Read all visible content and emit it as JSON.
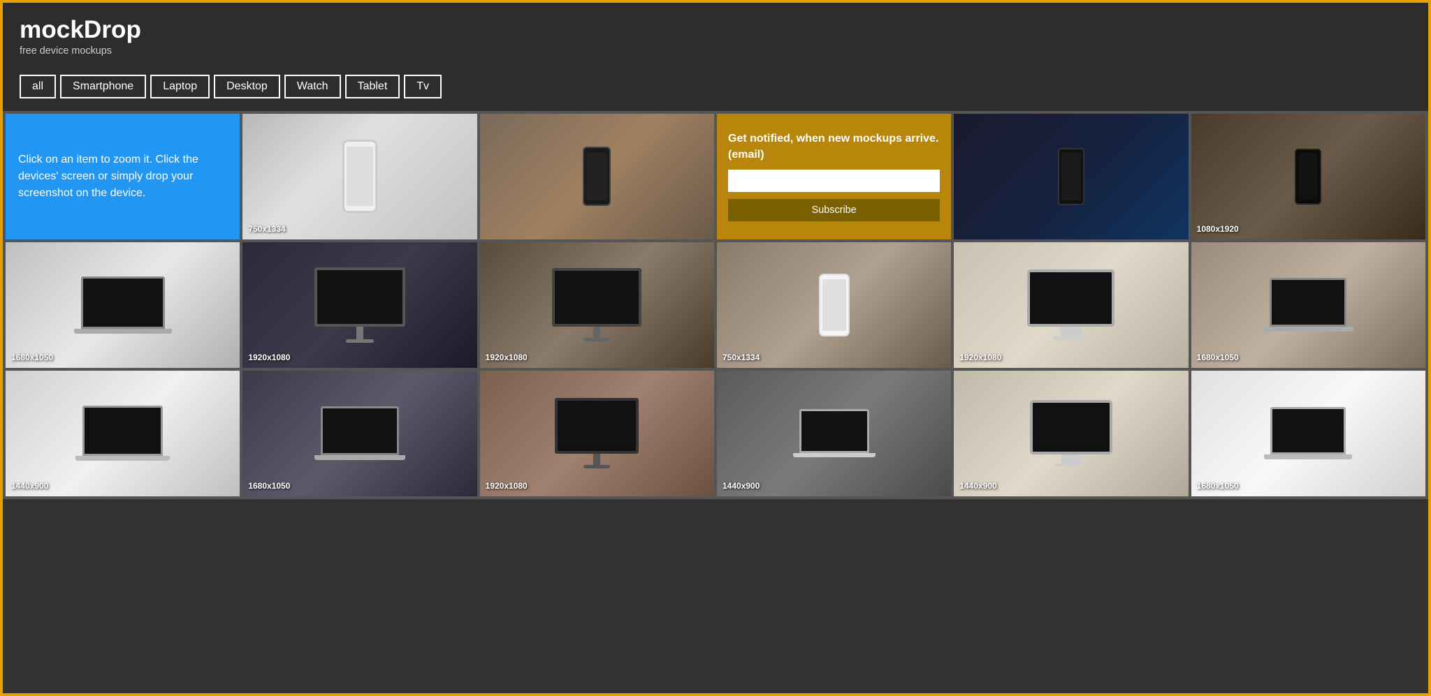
{
  "header": {
    "title": "mockDrop",
    "subtitle": "free device mockups"
  },
  "filters": {
    "buttons": [
      {
        "label": "all",
        "id": "filter-all"
      },
      {
        "label": "Smartphone",
        "id": "filter-smartphone"
      },
      {
        "label": "Laptop",
        "id": "filter-laptop"
      },
      {
        "label": "Desktop",
        "id": "filter-desktop"
      },
      {
        "label": "Watch",
        "id": "filter-watch"
      },
      {
        "label": "Tablet",
        "id": "filter-tablet"
      },
      {
        "label": "Tv",
        "id": "filter-tv"
      }
    ]
  },
  "info_box": {
    "text": "Click on an item to zoom it. Click the devices' screen or simply drop your screenshot on the device."
  },
  "notify_box": {
    "heading": "Get notified, when new mockups arrive. (email)",
    "input_placeholder": "",
    "button_label": "Subscribe"
  },
  "grid_items": [
    {
      "id": "item-1",
      "type": "info"
    },
    {
      "id": "item-2",
      "type": "phone",
      "size": "750x1334",
      "photo": "photo-1"
    },
    {
      "id": "item-3",
      "type": "phone_dark",
      "size": "",
      "photo": "photo-2"
    },
    {
      "id": "item-4",
      "type": "notify"
    },
    {
      "id": "item-5",
      "type": "phone_holding",
      "size": "",
      "photo": "photo-3"
    },
    {
      "id": "item-6",
      "type": "phone_holding2",
      "size": "1080x1920",
      "photo": "photo-4"
    },
    {
      "id": "item-7",
      "type": "laptop",
      "size": "1680x1050",
      "photo": "photo-5"
    },
    {
      "id": "item-8",
      "type": "monitor",
      "size": "1920x1080",
      "photo": "photo-6"
    },
    {
      "id": "item-9",
      "type": "monitor",
      "size": "1920x1080",
      "photo": "photo-7"
    },
    {
      "id": "item-10",
      "type": "phone",
      "size": "750x1334",
      "photo": "photo-8"
    },
    {
      "id": "item-11",
      "type": "monitor_desk",
      "size": "1920x1080",
      "photo": "photo-9"
    },
    {
      "id": "item-12",
      "type": "laptop_person",
      "size": "1680x1050",
      "photo": "photo-10"
    },
    {
      "id": "item-13",
      "type": "laptop",
      "size": "1440x900",
      "photo": "photo-11"
    },
    {
      "id": "item-14",
      "type": "laptop",
      "size": "1680x1050",
      "photo": "photo-12"
    },
    {
      "id": "item-15",
      "type": "monitor",
      "size": "1920x1080",
      "photo": "photo-13"
    },
    {
      "id": "item-16",
      "type": "laptop_desk",
      "size": "1440x900",
      "photo": "photo-14"
    },
    {
      "id": "item-17",
      "type": "monitor_desk2",
      "size": "1440x900",
      "photo": "photo-15"
    },
    {
      "id": "item-18",
      "type": "laptop_person2",
      "size": "1680x1050",
      "photo": "photo-16"
    }
  ]
}
